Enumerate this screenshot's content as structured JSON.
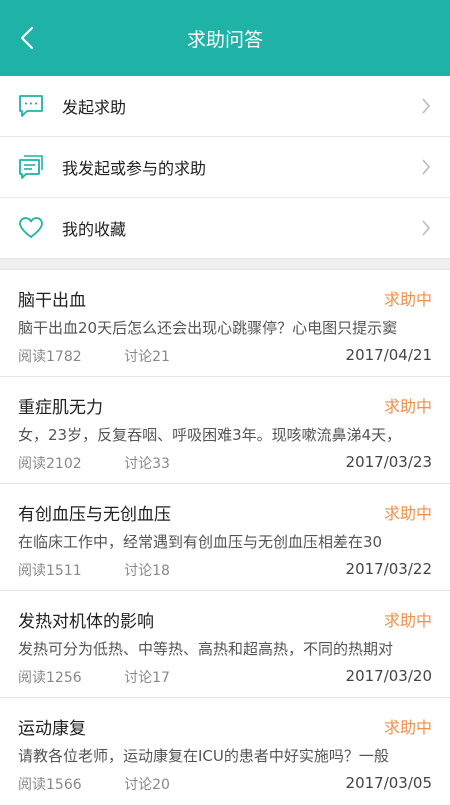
{
  "header": {
    "title": "求助问答"
  },
  "menu": [
    {
      "label": "发起求助",
      "icon": "chat-bubble-icon"
    },
    {
      "label": "我发起或参与的求助",
      "icon": "message-list-icon"
    },
    {
      "label": "我的收藏",
      "icon": "heart-icon"
    }
  ],
  "posts": [
    {
      "title": "脑干出血",
      "status": "求助中",
      "summary": "脑干出血20天后怎么还会出现心跳骤停？心电图只提示窦",
      "reads": "阅读1782",
      "comments": "讨论21",
      "date": "2017/04/21"
    },
    {
      "title": "重症肌无力",
      "status": "求助中",
      "summary": "女，23岁，反复吞咽、呼吸困难3年。现咳嗽流鼻涕4天，",
      "reads": "阅读2102",
      "comments": "讨论33",
      "date": "2017/03/23"
    },
    {
      "title": "有创血压与无创血压",
      "status": "求助中",
      "summary": "在临床工作中，经常遇到有创血压与无创血压相差在30",
      "reads": "阅读1511",
      "comments": "讨论18",
      "date": "2017/03/22"
    },
    {
      "title": "发热对机体的影响",
      "status": "求助中",
      "summary": "发热可分为低热、中等热、高热和超高热，不同的热期对",
      "reads": "阅读1256",
      "comments": "讨论17",
      "date": "2017/03/20"
    },
    {
      "title": "运动康复",
      "status": "求助中",
      "summary": "请教各位老师，运动康复在ICU的患者中好实施吗？一般",
      "reads": "阅读1566",
      "comments": "讨论20",
      "date": "2017/03/05"
    }
  ],
  "colors": {
    "accent": "#1fb3a8",
    "status": "#f2904b"
  }
}
